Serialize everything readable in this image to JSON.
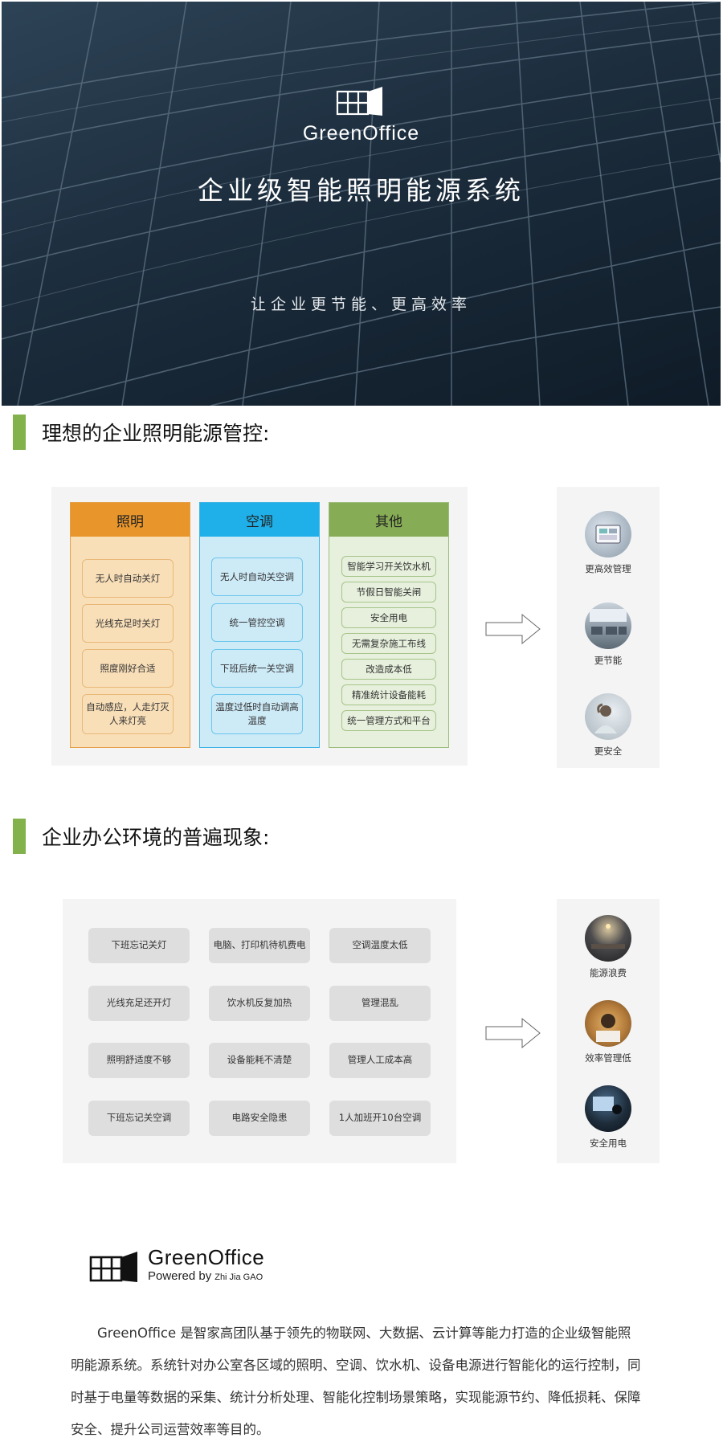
{
  "hero": {
    "brand": "GreenOffice",
    "title": "企业级智能照明能源系统",
    "tagline": "让企业更节能、更高效率"
  },
  "section1": {
    "title": "理想的企业照明能源管控:",
    "columns": [
      {
        "title": "照明",
        "items": [
          "无人时自动关灯",
          "光线充足时关灯",
          "照度刚好合适",
          "自动感应，人走灯灭人来灯亮"
        ]
      },
      {
        "title": "空调",
        "items": [
          "无人时自动关空调",
          "统一管控空调",
          "下班后统一关空调",
          "温度过低时自动调高温度"
        ]
      },
      {
        "title": "其他",
        "items": [
          "智能学习开关饮水机",
          "节假日智能关闸",
          "安全用电",
          "无需复杂施工布线",
          "改造成本低",
          "精准统计设备能耗",
          "统一管理方式和平台"
        ]
      }
    ],
    "benefits": [
      {
        "label": "更高效管理",
        "icon": "tablet-dashboard-photo-icon"
      },
      {
        "label": "更节能",
        "icon": "office-space-photo-icon"
      },
      {
        "label": "更安全",
        "icon": "relaxed-worker-photo-icon"
      }
    ]
  },
  "section2": {
    "title": "企业办公环境的普遍现象:",
    "chips": [
      "下班忘记关灯",
      "电脑、打印机待机费电",
      "空调温度太低",
      "光线充足还开灯",
      "饮水机反复加热",
      "管理混乱",
      "照明舒适度不够",
      "设备能耗不清楚",
      "管理人工成本高",
      "下班忘记关空调",
      "电路安全隐患",
      "1人加班开10台空调"
    ],
    "problems": [
      {
        "label": "能源浪费",
        "icon": "dark-office-lamp-photo-icon"
      },
      {
        "label": "效率管理低",
        "icon": "stressed-worker-photo-icon"
      },
      {
        "label": "安全用电",
        "icon": "worker-at-night-photo-icon"
      }
    ]
  },
  "footer": {
    "brand": "GreenOffice",
    "powered": "Powered by",
    "company": "Zhi Jia GAO",
    "paragraph": "GreenOffice 是智家高团队基于领先的物联网、大数据、云计算等能力打造的企业级智能照明能源系统。系统针对办公室各区域的照明、空调、饮水机、设备电源进行智能化的运行控制，同时基于电量等数据的采集、统计分析处理、智能化控制场景策略，实现能源节约、降低损耗、保障安全、提升公司运营效率等目的。"
  },
  "colors": {
    "accent_green": "#83b24c",
    "lighting_orange": "#e8962b",
    "ac_blue": "#1fb0ea",
    "other_green": "#86ad55"
  }
}
